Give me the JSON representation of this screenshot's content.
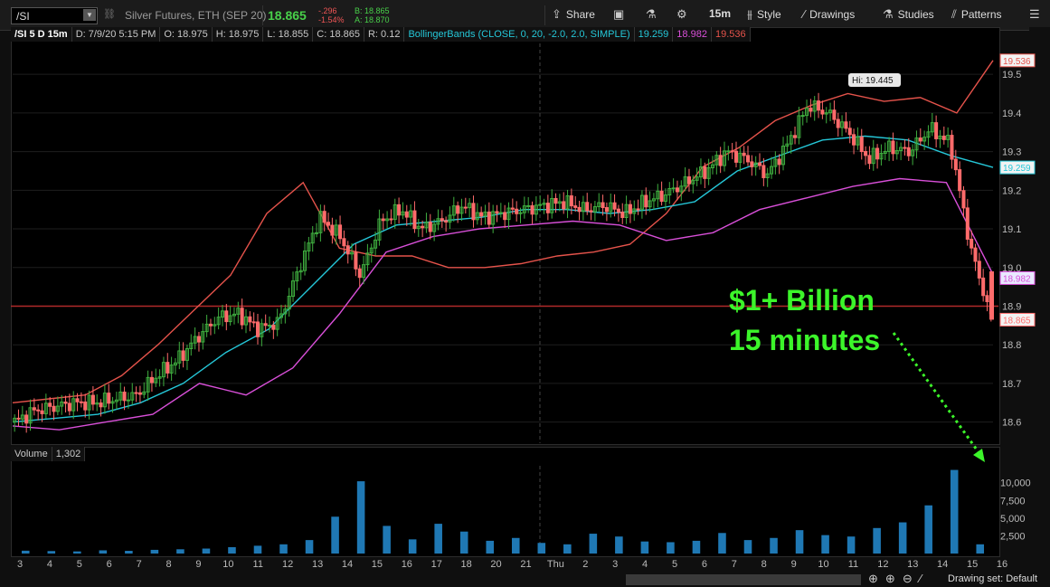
{
  "toolbar": {
    "symbol": "/SI",
    "description": "Silver Futures, ETH (SEP 20)",
    "last_price": "18.865",
    "change": "-.296",
    "change_pct": "-1.54%",
    "bid": "B: 18.865",
    "ask": "A: 18.870",
    "share": "Share",
    "timeframe": "15m",
    "style": "Style",
    "drawings": "Drawings",
    "studies": "Studies",
    "patterns": "Patterns"
  },
  "study_bar": {
    "title": "/SI 5 D 15m",
    "date": "D: 7/9/20 5:15 PM",
    "open": "O: 18.975",
    "high": "H: 18.975",
    "low": "L: 18.855",
    "close": "C: 18.865",
    "range": "R: 0.12",
    "study": "BollingerBands (CLOSE, 0, 20, -2.0, 2.0, SIMPLE)",
    "mid": "19.259",
    "lower": "18.982",
    "upper": "19.536"
  },
  "volume_head": {
    "label": "Volume",
    "value": "1,302"
  },
  "hi_label": "Hi: 19.445",
  "annotation": {
    "line1": "$1+ Billion",
    "line2": "15 minutes"
  },
  "colors": {
    "up": "#3fae3f",
    "down": "#ff6b6b",
    "upper_band": "#e5534b",
    "mid_band": "#25c7d8",
    "lower_band": "#d84fd8",
    "annotation": "#3cf52a",
    "volume": "#1f78b4"
  },
  "price_axis": {
    "ticks": [
      "19.5",
      "19.4",
      "19.3",
      "19.2",
      "19.1",
      "19.0",
      "18.9",
      "18.8",
      "18.7",
      "18.6"
    ]
  },
  "price_tags": [
    {
      "value": "19.536",
      "kind": "upper"
    },
    {
      "value": "19.259",
      "kind": "mid"
    },
    {
      "value": "18.982",
      "kind": "lower"
    },
    {
      "value": "18.865",
      "kind": "last"
    }
  ],
  "volume_axis": {
    "ticks": [
      "10,000",
      "7,500",
      "5,000",
      "2,500"
    ]
  },
  "time_axis": {
    "labels": [
      "3",
      "4",
      "5",
      "6",
      "7",
      "8",
      "9",
      "10",
      "11",
      "12",
      "13",
      "14",
      "15",
      "16",
      "17",
      "18",
      "20",
      "21",
      "Thu",
      "2",
      "3",
      "4",
      "5",
      "6",
      "7",
      "8",
      "9",
      "10",
      "11",
      "12",
      "13",
      "14",
      "15",
      "16"
    ]
  },
  "drawing_set": "Drawing set: Default",
  "chart_data": {
    "type": "candlestick",
    "title": "/SI 5 D 15m",
    "series": [
      {
        "name": "Price path (approx closes)",
        "values": [
          18.6,
          18.63,
          18.64,
          18.65,
          18.65,
          18.66,
          18.67,
          18.72,
          18.76,
          18.82,
          18.87,
          18.88,
          18.84,
          18.86,
          19.0,
          19.13,
          19.08,
          18.98,
          19.12,
          19.15,
          19.1,
          19.12,
          19.16,
          19.13,
          19.14,
          19.15,
          19.16,
          19.17,
          19.15,
          19.16,
          19.14,
          19.17,
          19.19,
          19.22,
          19.25,
          19.3,
          19.28,
          19.24,
          19.32,
          19.42,
          19.4,
          19.35,
          19.28,
          19.31,
          19.3,
          19.36,
          19.32,
          19.05,
          18.87
        ]
      },
      {
        "name": "BollingerBands upper",
        "values": [
          18.65,
          18.66,
          18.67,
          18.72,
          18.8,
          18.89,
          18.98,
          19.14,
          19.22,
          19.05,
          19.03,
          19.03,
          19.0,
          19.0,
          19.01,
          19.03,
          19.04,
          19.06,
          19.14,
          19.26,
          19.31,
          19.38,
          19.42,
          19.45,
          19.43,
          19.44,
          19.4,
          19.536
        ]
      },
      {
        "name": "BollingerBands mid",
        "values": [
          18.6,
          18.61,
          18.62,
          18.65,
          18.7,
          18.78,
          18.84,
          18.95,
          19.06,
          19.11,
          19.12,
          19.13,
          19.15,
          19.15,
          19.14,
          19.15,
          19.17,
          19.25,
          19.29,
          19.33,
          19.34,
          19.33,
          19.29,
          19.259
        ]
      },
      {
        "name": "BollingerBands lower",
        "values": [
          18.59,
          18.58,
          18.6,
          18.62,
          18.7,
          18.67,
          18.74,
          18.88,
          19.04,
          19.08,
          19.1,
          19.11,
          19.12,
          19.11,
          19.07,
          19.09,
          19.15,
          19.18,
          19.21,
          19.23,
          19.22,
          18.982
        ]
      }
    ],
    "volume_values": [
      400,
      350,
      300,
      450,
      380,
      520,
      600,
      700,
      900,
      1100,
      1300,
      1900,
      5200,
      10200,
      3900,
      2000,
      4200,
      3100,
      1800,
      2200,
      1500,
      1300,
      2800,
      2400,
      1700,
      1600,
      1800,
      2900,
      1900,
      2200,
      3300,
      2600,
      2400,
      3600,
      4400,
      6800,
      11800,
      1302
    ],
    "x_labels": [
      "3",
      "4",
      "5",
      "6",
      "7",
      "8",
      "9",
      "10",
      "11",
      "12",
      "13",
      "14",
      "15",
      "16",
      "17",
      "18",
      "20",
      "21",
      "Thu",
      "2",
      "3",
      "4",
      "5",
      "6",
      "7",
      "8",
      "9",
      "10",
      "11",
      "12",
      "13",
      "14",
      "15",
      "16"
    ],
    "ylim": [
      18.55,
      19.58
    ],
    "annotations": [
      "Hi: 19.445",
      "$1+ Billion",
      "15 minutes"
    ],
    "last_close": 18.865
  }
}
